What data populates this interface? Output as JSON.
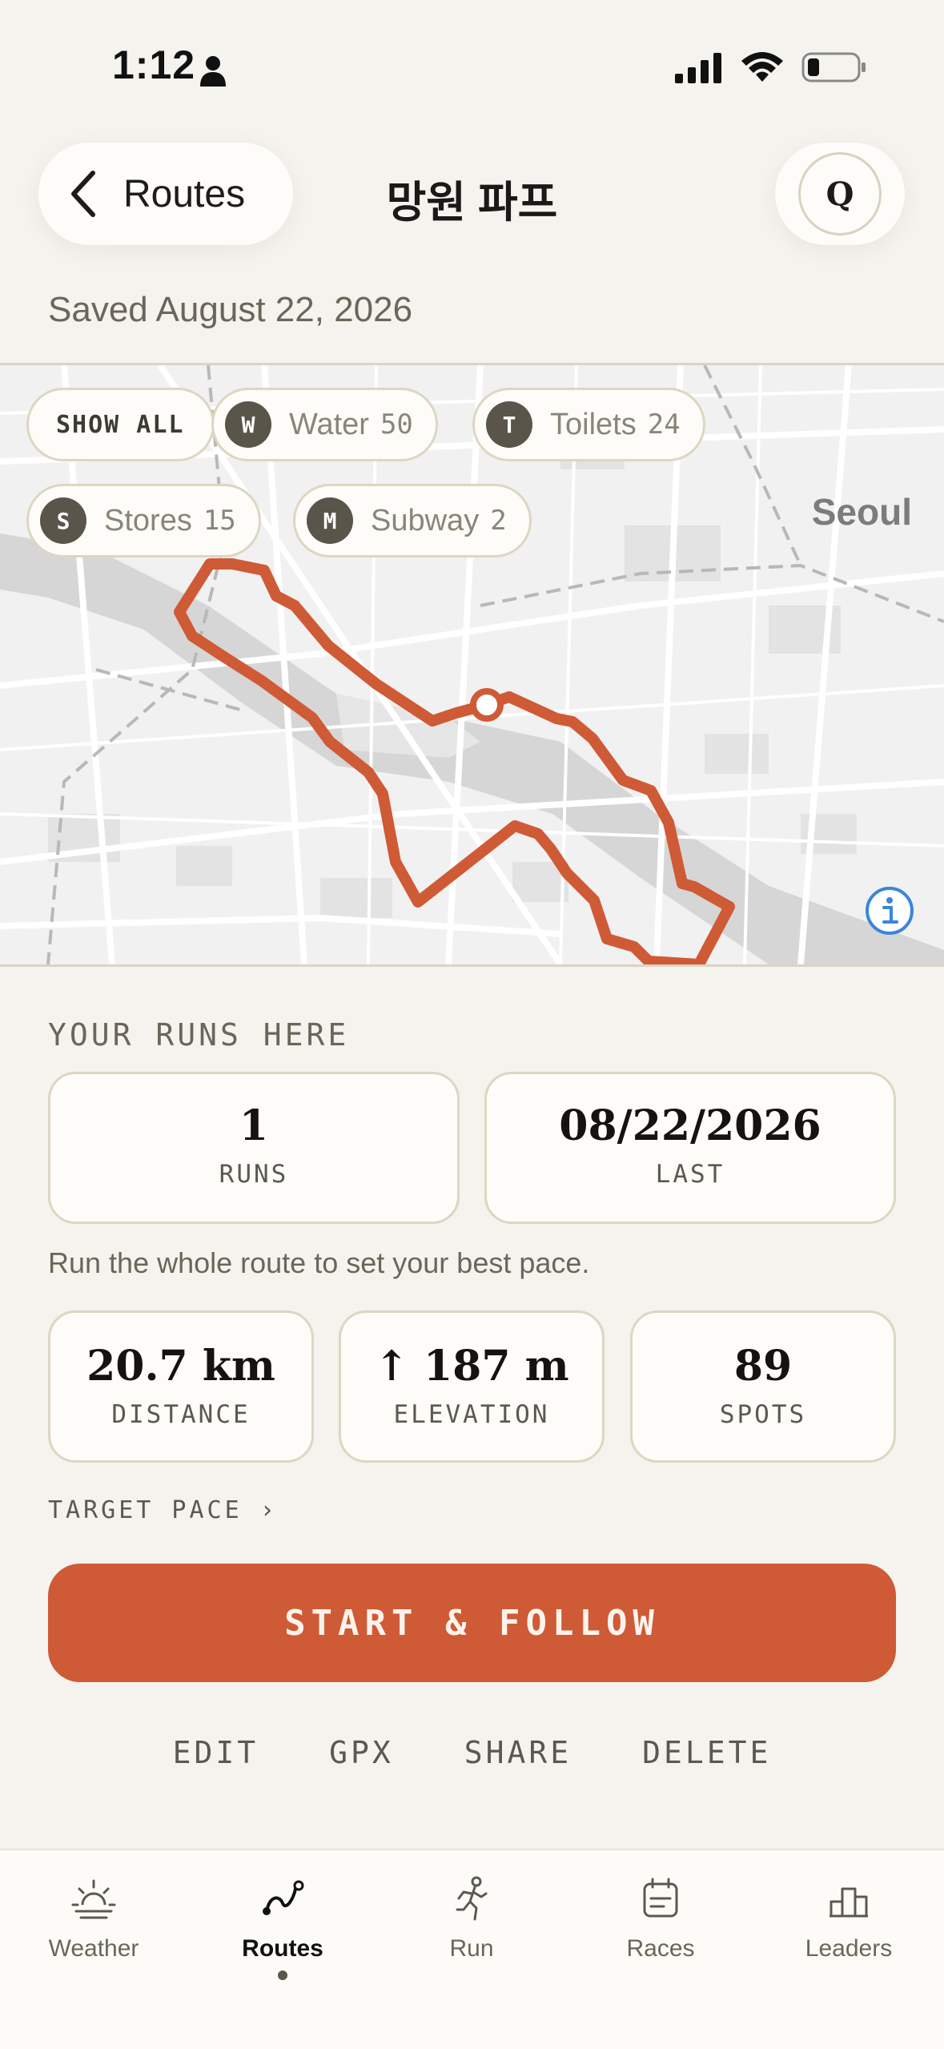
{
  "status_bar": {
    "time": "1:12"
  },
  "header": {
    "back_label": "Routes",
    "title": "망원 파프",
    "avatar_letter": "Q"
  },
  "saved_date": "Saved August 22, 2026",
  "map": {
    "show_all_label": "SHOW ALL",
    "chips": [
      {
        "badge": "W",
        "name": "Water",
        "count": "50"
      },
      {
        "badge": "T",
        "name": "Toilets",
        "count": "24"
      },
      {
        "badge": "S",
        "name": "Stores",
        "count": "15"
      },
      {
        "badge": "M",
        "name": "Subway",
        "count": "2"
      }
    ],
    "city_label": "Seoul",
    "route_color": "#cf5a36"
  },
  "runs_here": {
    "section_label": "YOUR RUNS HERE",
    "runs_value": "1",
    "runs_label": "RUNS",
    "last_value": "08/22/2026",
    "last_label": "LAST",
    "hint": "Run the whole route to set your best pace."
  },
  "stats": {
    "distance_value": "20.7 km",
    "distance_label": "DISTANCE",
    "elevation_value": "↑ 187 m",
    "elevation_label": "ELEVATION",
    "spots_value": "89",
    "spots_label": "SPOTS"
  },
  "target_pace_label": "TARGET PACE ›",
  "start_button_label": "START & FOLLOW",
  "actions": {
    "edit": "EDIT",
    "gpx": "GPX",
    "share": "SHARE",
    "delete": "DELETE"
  },
  "tabs": [
    {
      "label": "Weather",
      "icon": "weather-icon"
    },
    {
      "label": "Routes",
      "icon": "route-icon",
      "active": true
    },
    {
      "label": "Run",
      "icon": "runner-icon"
    },
    {
      "label": "Races",
      "icon": "calendar-icon"
    },
    {
      "label": "Leaders",
      "icon": "podium-icon"
    }
  ],
  "colors": {
    "accent": "#cf5a36",
    "background": "#f5f3ee",
    "card": "#fdfcf8",
    "border": "#ddd6c2"
  }
}
